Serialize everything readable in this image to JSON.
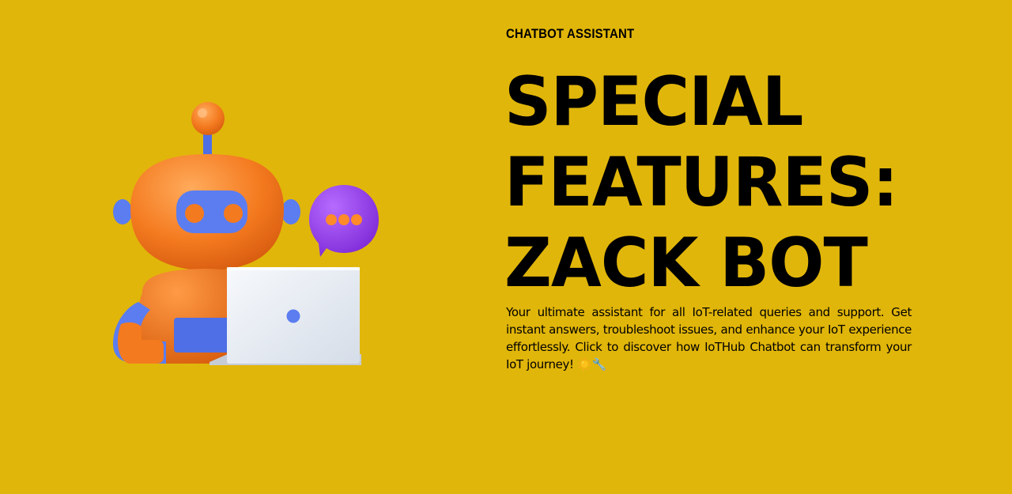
{
  "hero": {
    "eyebrow": "CHATBOT ASSISTANT",
    "headline_lines": [
      "SPECIAL",
      "FEATURES:",
      "ZACK BOT"
    ],
    "description": "Your ultimate assistant for all IoT-related queries and support. Get instant answers, troubleshoot issues, and enhance your IoT experience effortlessly. Click to discover how IoTHub Chatbot can transform your IoT journey! ☀️🔧"
  },
  "illustration": {
    "icon": "robot-with-laptop-icon",
    "bubble_icon": "chat-bubble-icon"
  },
  "colors": {
    "background": "#e1b60a",
    "robot_orange": "#f47a1f",
    "robot_blue": "#5b7df0",
    "bubble_purple": "#9a3df5",
    "laptop": "#e9eef5"
  }
}
